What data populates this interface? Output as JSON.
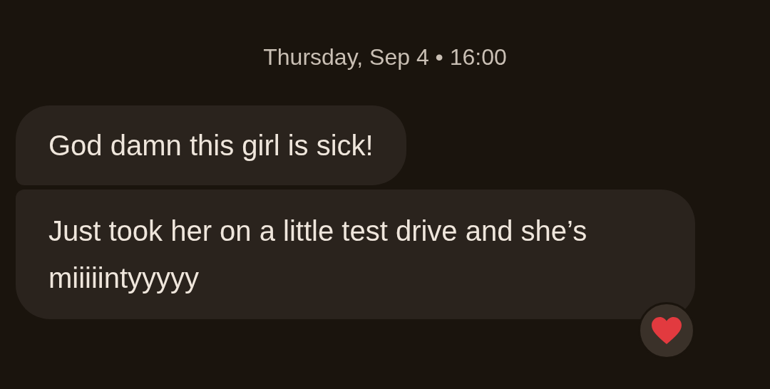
{
  "timestamp": "Thursday, Sep 4 • 16:00",
  "messages": [
    {
      "text": "God damn this girl is sick!",
      "reacted": false
    },
    {
      "text": "Just took her on a little test drive and she’s miiiiintyyyyy",
      "reacted": true
    }
  ]
}
